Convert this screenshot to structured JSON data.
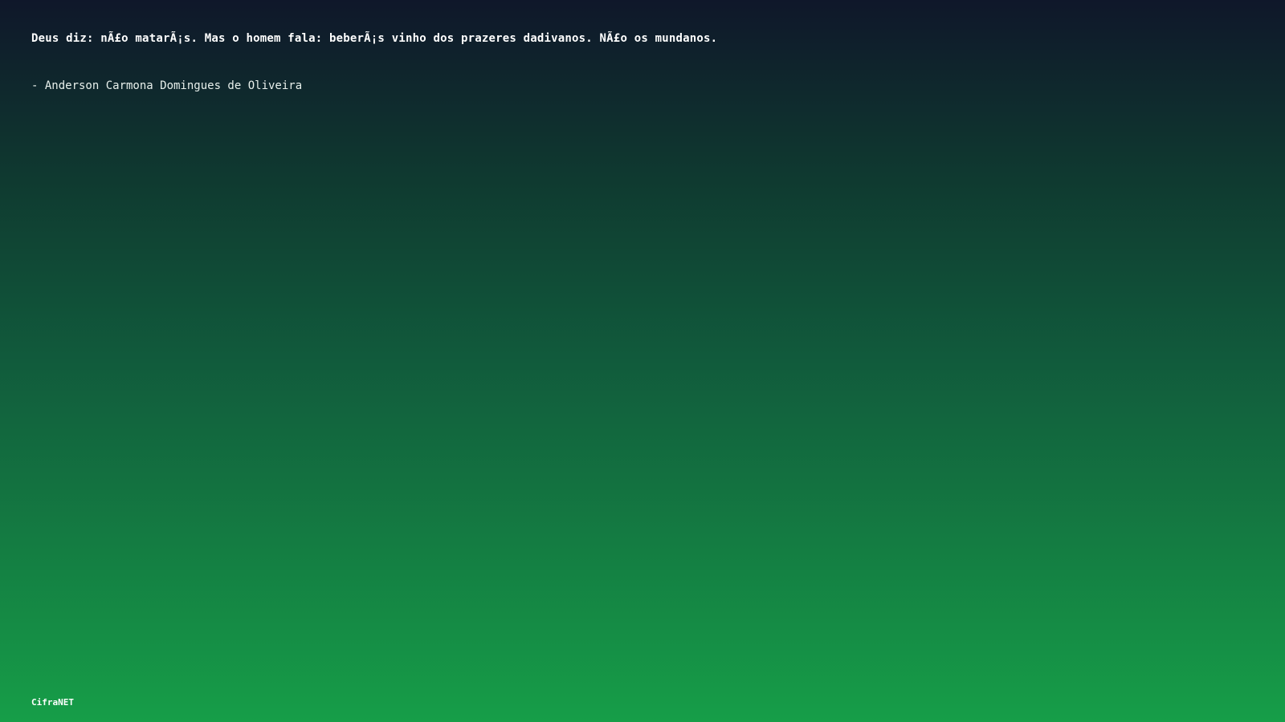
{
  "quote": {
    "text": "Deus diz: nÃ£o matarÃ¡s. Mas o homem fala: beberÃ¡s vinho dos prazeres dadivanos. NÃ£o os mundanos.",
    "author": "- Anderson Carmona Domingues de Oliveira"
  },
  "brand": {
    "label": "CifraNET"
  },
  "colors": {
    "gradient_top": "#0f172a",
    "gradient_bottom": "#169e48",
    "text": "#ffffff"
  }
}
